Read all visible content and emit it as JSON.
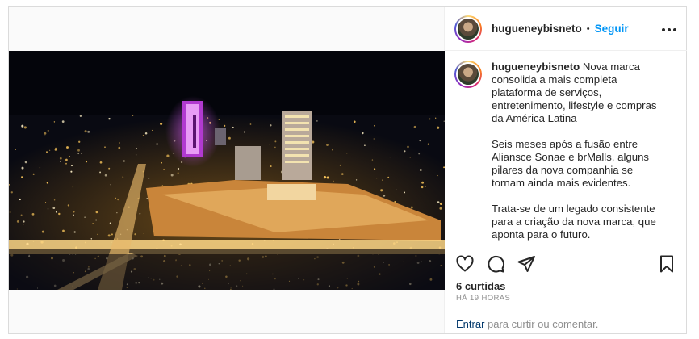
{
  "post": {
    "username": "hugueneybisneto",
    "separator": "•",
    "follow_label": "Seguir",
    "more_label": "•••"
  },
  "caption": {
    "username": "hugueneybisneto",
    "paragraph_1": "Nova marca consolida a mais completa plataforma de serviços, entretenimento, lifestyle e compras da América Latina",
    "paragraph_2": "Seis meses após a fusão entre Aliansce Sonae e brMalls, alguns pilares da nova companhia se tornam ainda mais evidentes.",
    "paragraph_3": "Trata-se de um legado consistente para a criação da nova marca, que aponta para o futuro."
  },
  "stats": {
    "likes": "6 curtidas",
    "time": "HÁ 19 HORAS"
  },
  "comment_bar": {
    "login_link": "Entrar",
    "text": " para curtir ou comentar."
  },
  "icons": {
    "like": "heart-icon",
    "comment": "comment-icon",
    "share": "paper-plane-icon",
    "save": "bookmark-icon"
  },
  "colors": {
    "accent": "#0095f6",
    "tower_light": "#c23bd8",
    "city_lights": "#f2c14e"
  }
}
